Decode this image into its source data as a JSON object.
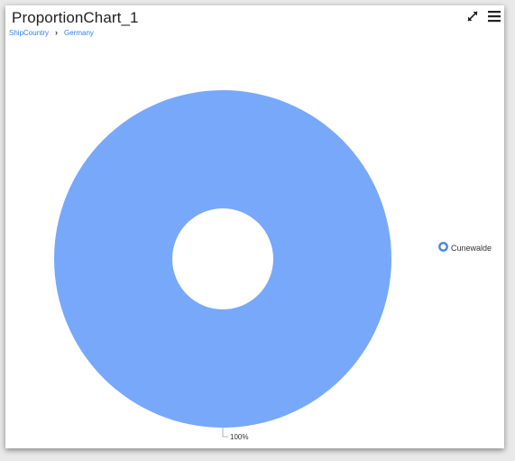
{
  "header": {
    "title": "ProportionChart_1"
  },
  "breadcrumb": {
    "items": [
      "ShipCountry",
      "Germany"
    ],
    "separator": "›"
  },
  "toolbar": {
    "expand_icon": "expand-arrows-icon",
    "menu_icon": "hamburger-menu-icon"
  },
  "chart_data": {
    "type": "pie",
    "variant": "donut",
    "categories": [
      "Cunewalde"
    ],
    "values": [
      100
    ],
    "data_labels": [
      "100%"
    ],
    "legend_position": "right",
    "colors": [
      "#78a8fa"
    ]
  }
}
